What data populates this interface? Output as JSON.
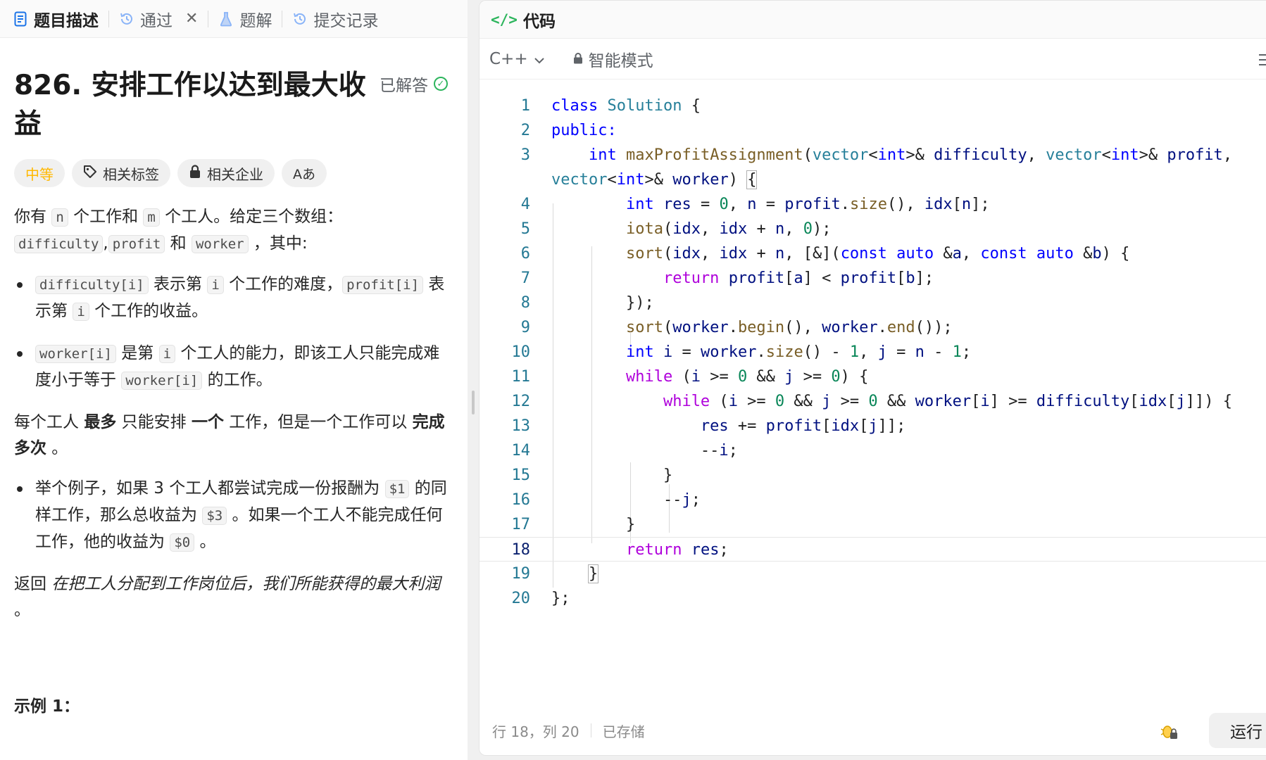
{
  "left_tabs": [
    {
      "label": "题目描述",
      "icon": "doc-icon"
    },
    {
      "label": "通过",
      "icon": "history-icon"
    },
    {
      "label": "题解",
      "icon": "flask-icon"
    },
    {
      "label": "提交记录",
      "icon": "history-icon"
    }
  ],
  "problem": {
    "title": "826. 安排工作以达到最大收益",
    "solved_label": "已解答",
    "tags": {
      "difficulty": "中等",
      "related_tags": "相关标签",
      "companies": "相关企业",
      "font_btn": "Aあ"
    },
    "p1": {
      "a": "你有 ",
      "n": "n",
      "b": " 个工作和 ",
      "m": "m",
      "c": " 个工人。给定三个数组：",
      "d": "difficulty",
      "e": ",",
      "f": "profit",
      "g": " 和 ",
      "h": "worker",
      "i": " ，其中:"
    },
    "bullet1": {
      "c1": "difficulty[i]",
      "t1": " 表示第 ",
      "c2": "i",
      "t2": " 个工作的难度，",
      "c3": "profit[i]",
      "t3": " 表示第 ",
      "c4": "i",
      "t4": " 个工作的收益。"
    },
    "bullet2": {
      "c1": "worker[i]",
      "t1": " 是第 ",
      "c2": "i",
      "t2": " 个工人的能力，即该工人只能完成难度小于等于 ",
      "c3": "worker[i]",
      "t3": " 的工作。"
    },
    "p2": {
      "a": "每个工人 ",
      "b": "最多",
      "c": " 只能安排 ",
      "d": "一个",
      "e": " 工作，但是一个工作可以 ",
      "f": "完成多次",
      "g": " 。"
    },
    "bullet3": {
      "t1": "举个例子，如果 3 个工人都尝试完成一份报酬为 ",
      "c1": "$1",
      "t2": " 的同样工作，那么总收益为 ",
      "c2": "$3",
      "t3": " 。如果一个工人不能完成任何工作，他的收益为 ",
      "c3": "$0",
      "t4": " 。"
    },
    "p3": {
      "a": "返回 ",
      "b": "在把工人分配到工作岗位后，我们所能获得的最大利润",
      "c": " 。"
    },
    "example_heading": "示例 1："
  },
  "editor": {
    "header_title": "代码",
    "language": "C++",
    "mode": "智能模式",
    "current_line": 18,
    "lines": [
      "1",
      "2",
      "3",
      "",
      "4",
      "5",
      "6",
      "7",
      "8",
      "9",
      "10",
      "11",
      "12",
      "13",
      "14",
      "15",
      "16",
      "17",
      "18",
      "19",
      "20"
    ]
  },
  "status": {
    "position": "行 18，列 20",
    "saved": "已存储",
    "run_button": "运行"
  }
}
